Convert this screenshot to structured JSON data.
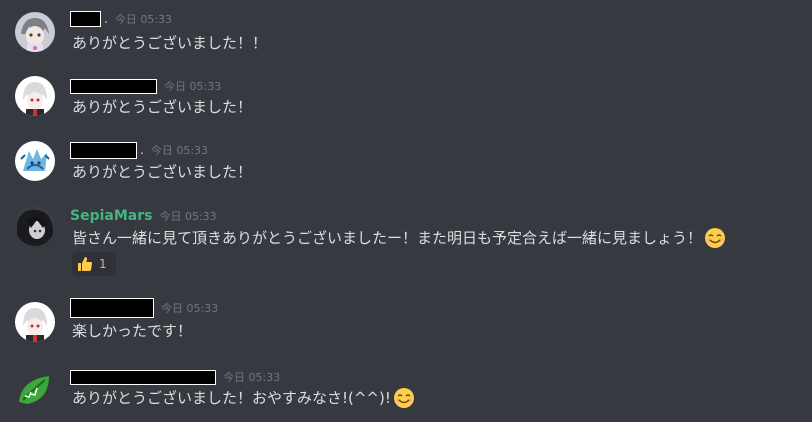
{
  "messages": [
    {
      "timestamp": "今日 05:33",
      "text": "ありがとうございました！！",
      "name_suffix": "."
    },
    {
      "timestamp": "今日 05:33",
      "text": "ありがとうございました！"
    },
    {
      "timestamp": "今日 05:33",
      "text": "ありがとうございました！",
      "name_suffix": "."
    },
    {
      "username": "SepiaMars",
      "username_color": "#43b581",
      "timestamp": "今日 05:33",
      "text": "皆さん一緒に見て頂きありがとうございましたー！また明日も予定合えば一緒に見ましょう！",
      "emoji": "smiling-face-emoji",
      "reaction": {
        "emoji": "thumbs-up-emoji",
        "count": "1"
      }
    },
    {
      "timestamp": "今日 05:33",
      "text": "楽しかったです！"
    },
    {
      "timestamp": "今日 05:33",
      "text": "ありがとうございました！おやすみなさ!(^^)!",
      "emoji": "smiling-face-emoji"
    }
  ],
  "colors": {
    "background": "#36393f",
    "text": "#dcddde",
    "timestamp": "#72767d",
    "reaction_bg": "#2f3136"
  }
}
